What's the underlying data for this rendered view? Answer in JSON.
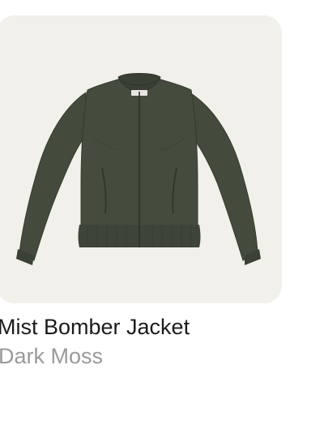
{
  "product": {
    "name": "Mist Bomber Jacket",
    "color": "Dark Moss",
    "image": {
      "subject": "jacket-icon",
      "label_text": "GNOSS"
    }
  },
  "colors": {
    "card_background": "#f2f0ea",
    "jacket": "#444b3d",
    "jacket_shadow": "#353b2f",
    "name_text": "#1b1b1b",
    "color_text": "#9a9a9a"
  }
}
